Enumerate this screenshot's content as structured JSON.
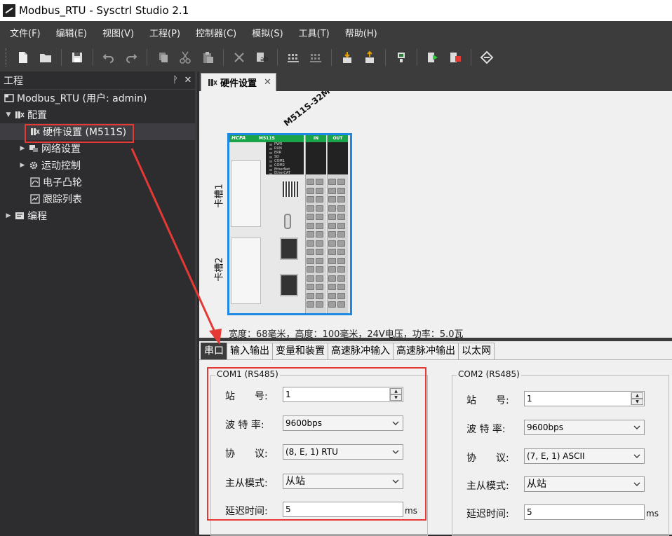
{
  "window": {
    "title": "Modbus_RTU - Sysctrl Studio 2.1"
  },
  "menu": [
    "文件(F)",
    "编辑(E)",
    "视图(V)",
    "工程(P)",
    "控制器(C)",
    "模拟(S)",
    "工具(T)",
    "帮助(H)"
  ],
  "project_panel": {
    "title": "工程",
    "pin": "ᚹ",
    "close": "✕",
    "root": "Modbus_RTU (用户: admin)",
    "config": "配置",
    "hardware": "硬件设置 (M511S)",
    "network": "网络设置",
    "motion": "运动控制",
    "cam": "电子凸轮",
    "trace": "跟踪列表",
    "programming": "编程"
  },
  "document": {
    "tab": "硬件设置",
    "tab_close": "✕",
    "device_model": "M511S-32M",
    "brand_logo": "HCFA",
    "device_short": "M511S",
    "slot1": "卡槽1",
    "slot2": "卡槽2",
    "io_in": "IN",
    "io_out": "OUT",
    "leds": [
      "PWR",
      "RUN",
      "ERR",
      "SD",
      "COM1",
      "COM2",
      "EtherNet",
      "EtherCAT"
    ],
    "spec": "宽度：68毫米，高度：100毫米，24V电压，功率：5.0瓦"
  },
  "settings_tabs": [
    "串口",
    "输入输出",
    "变量和装置",
    "高速脉冲输入",
    "高速脉冲输出",
    "以太网"
  ],
  "com1": {
    "title": "COM1 (RS485)",
    "station_label": "站　　号:",
    "station": "1",
    "baud_label": "波 特 率:",
    "baud": "9600bps",
    "protocol_label": "协　　议:",
    "protocol": "(8, E, 1) RTU",
    "mode_label": "主从模式:",
    "mode": "从站",
    "delay_label": "延迟时间:",
    "delay": "5",
    "delay_unit": "ms"
  },
  "com2": {
    "title": "COM2 (RS485)",
    "station_label": "站　　号:",
    "station": "1",
    "baud_label": "波 特 率:",
    "baud": "9600bps",
    "protocol_label": "协　　议:",
    "protocol": "(7, E, 1) ASCII",
    "mode_label": "主从模式:",
    "mode": "从站",
    "delay_label": "延迟时间:",
    "delay": "5",
    "delay_unit": "ms"
  },
  "colors": {
    "annotation": "#e53935",
    "plc_border": "#1e88e5",
    "plc_green": "#1ba34a"
  }
}
